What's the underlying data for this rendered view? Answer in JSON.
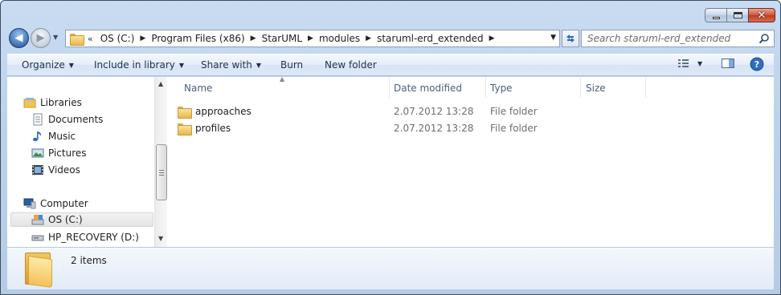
{
  "window": {
    "caption": {
      "minimize_icon": "minimize-icon",
      "maximize_icon": "maximize-icon",
      "close_icon": "close-icon"
    }
  },
  "nav": {
    "back_icon": "arrow-left-icon",
    "forward_icon": "arrow-right-icon",
    "overflow": "«",
    "breadcrumbs": [
      "OS (C:)",
      "Program Files (x86)",
      "StarUML",
      "modules",
      "staruml-erd_extended"
    ]
  },
  "search": {
    "placeholder": "Search staruml-erd_extended"
  },
  "toolbar": {
    "organize": "Organize",
    "include_in_library": "Include in library",
    "share_with": "Share with",
    "burn": "Burn",
    "new_folder": "New folder"
  },
  "sidebar": {
    "items": [
      {
        "label": "Libraries",
        "icon": "library-icon"
      },
      {
        "label": "Documents",
        "icon": "documents-icon"
      },
      {
        "label": "Music",
        "icon": "music-icon"
      },
      {
        "label": "Pictures",
        "icon": "pictures-icon"
      },
      {
        "label": "Videos",
        "icon": "videos-icon"
      },
      {
        "label": "Computer",
        "icon": "computer-icon"
      },
      {
        "label": "OS (C:)",
        "icon": "drive-icon"
      },
      {
        "label": "HP_RECOVERY (D:)",
        "icon": "drive-icon"
      }
    ]
  },
  "columns": {
    "name": "Name",
    "date": "Date modified",
    "type": "Type",
    "size": "Size"
  },
  "files": [
    {
      "name": "approaches",
      "date": "2.07.2012 13:28",
      "type": "File folder"
    },
    {
      "name": "profiles",
      "date": "2.07.2012 13:28",
      "type": "File folder"
    }
  ],
  "status": {
    "count": "2 items"
  },
  "colors": {
    "chrome": "#bcd2ec",
    "command_text": "#1e3050",
    "folder": "#f2c25a"
  }
}
